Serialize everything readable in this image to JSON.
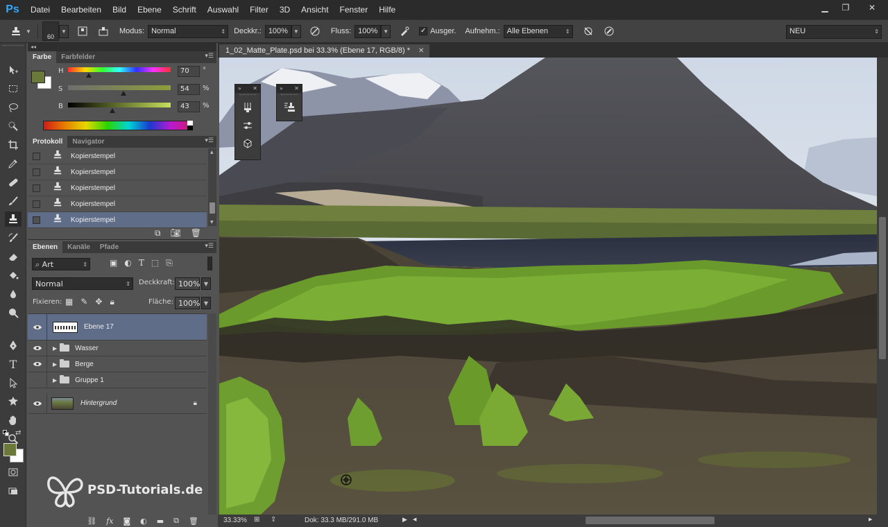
{
  "app": {
    "logo": "Ps",
    "menus": [
      "Datei",
      "Bearbeiten",
      "Bild",
      "Ebene",
      "Schrift",
      "Auswahl",
      "Filter",
      "3D",
      "Ansicht",
      "Fenster",
      "Hilfe"
    ],
    "window_controls": {
      "minimize": "▁",
      "restore": "❐",
      "close": "✕"
    }
  },
  "options_bar": {
    "brush_size": "60",
    "mode_label": "Modus:",
    "mode_value": "Normal",
    "opacity_label": "Deckkr.:",
    "opacity_value": "100%",
    "flow_label": "Fluss:",
    "flow_value": "100%",
    "aligned_label": "Ausger.",
    "sample_label": "Aufnehm.:",
    "sample_value": "Alle Ebenen",
    "workspace_value": "NEU"
  },
  "color_panel": {
    "tabs": [
      "Farbe",
      "Farbfelder"
    ],
    "sliders": [
      {
        "label": "H",
        "value": "70",
        "unit": "°",
        "level": 0.2
      },
      {
        "label": "S",
        "value": "54",
        "unit": "%",
        "level": 0.54
      },
      {
        "label": "B",
        "value": "43",
        "unit": "%",
        "level": 0.43
      }
    ],
    "foreground": "#6b7a3a",
    "background": "#ffffff"
  },
  "history_panel": {
    "tabs": [
      "Protokoll",
      "Navigator"
    ],
    "items": [
      "Kopierstempel",
      "Kopierstempel",
      "Kopierstempel",
      "Kopierstempel",
      "Kopierstempel"
    ],
    "selected_index": 4
  },
  "layers_panel": {
    "tabs": [
      "Ebenen",
      "Kanäle",
      "Pfade"
    ],
    "filter_value": "Art",
    "blend_value": "Normal",
    "opacity_label": "Deckkraft:",
    "opacity_value": "100%",
    "lock_label": "Fixieren:",
    "fill_label": "Fläche:",
    "fill_value": "100%",
    "layers": [
      {
        "name": "Ebene 17",
        "type": "layer",
        "visible": true
      },
      {
        "name": "Wasser",
        "type": "group",
        "visible": true
      },
      {
        "name": "Berge",
        "type": "group",
        "visible": true
      },
      {
        "name": "Gruppe 1",
        "type": "group",
        "visible": false
      },
      {
        "name": "Hintergrund",
        "type": "background",
        "visible": true
      }
    ]
  },
  "document": {
    "tab_title": "1_02_Matte_Plate.psd bei 33.3% (Ebene 17, RGB/8) *",
    "zoom": "33.33%",
    "doc_info": "Dok: 33.3 MB/291.0 MB"
  },
  "watermark": "PSD-Tutorials.de"
}
